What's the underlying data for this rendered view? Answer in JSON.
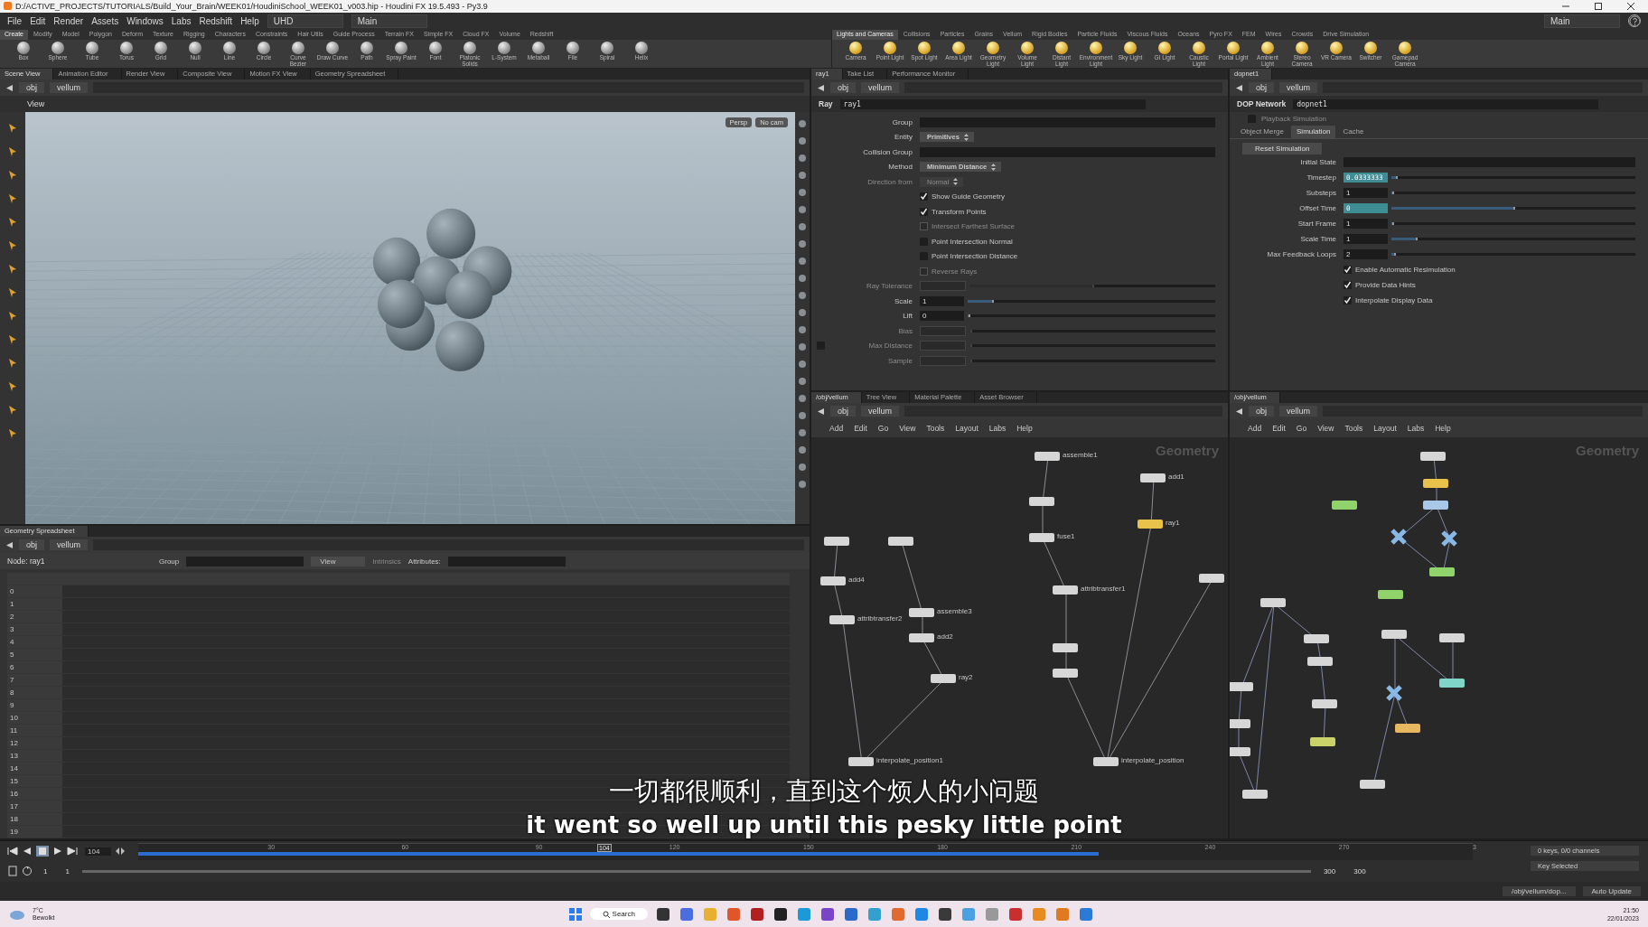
{
  "window": {
    "title": "D:/ACTIVE_PROJECTS/TUTORIALS/Build_Your_Brain/WEEK01/HoudiniSchool_WEEK01_v003.hip - Houdini FX 19.5.493 - Py3.9"
  },
  "menu": [
    "File",
    "Edit",
    "Render",
    "Assets",
    "Windows",
    "Labs",
    "Redshift",
    "Help"
  ],
  "desktop": "UHD",
  "layout_left": "Main",
  "layout_right": "Main",
  "shelf_left": {
    "tabs": [
      {
        "label": "Create",
        "selected": true
      },
      {
        "label": "Modify",
        "selected": false
      },
      {
        "label": "Model",
        "selected": false
      },
      {
        "label": "Polygon",
        "selected": false
      },
      {
        "label": "Deform",
        "selected": false
      },
      {
        "label": "Texture",
        "selected": false
      },
      {
        "label": "Rigging",
        "selected": false
      },
      {
        "label": "Characters",
        "selected": false
      },
      {
        "label": "Constraints",
        "selected": false
      },
      {
        "label": "Hair Utils",
        "selected": false
      },
      {
        "label": "Guide Process",
        "selected": false
      },
      {
        "label": "Terrain FX",
        "selected": false
      },
      {
        "label": "Simple FX",
        "selected": false
      },
      {
        "label": "Cloud FX",
        "selected": false
      },
      {
        "label": "Volume",
        "selected": false
      },
      {
        "label": "Redshift",
        "selected": false
      }
    ],
    "tools": [
      "Box",
      "Sphere",
      "Tube",
      "Torus",
      "Grid",
      "Null",
      "Line",
      "Circle",
      "Curve Bezier",
      "Draw Curve",
      "Path",
      "Spray Paint",
      "Font",
      "Platonic Solids",
      "L-System",
      "Metaball",
      "File",
      "Spiral",
      "Helix"
    ]
  },
  "shelf_right": {
    "tabs": [
      {
        "label": "Lights and Cameras",
        "selected": true
      },
      {
        "label": "Collisions",
        "selected": false
      },
      {
        "label": "Particles",
        "selected": false
      },
      {
        "label": "Grains",
        "selected": false
      },
      {
        "label": "Vellum",
        "selected": false
      },
      {
        "label": "Rigid Bodies",
        "selected": false
      },
      {
        "label": "Particle Fluids",
        "selected": false
      },
      {
        "label": "Viscous Fluids",
        "selected": false
      },
      {
        "label": "Oceans",
        "selected": false
      },
      {
        "label": "Pyro FX",
        "selected": false
      },
      {
        "label": "FEM",
        "selected": false
      },
      {
        "label": "Wires",
        "selected": false
      },
      {
        "label": "Crowds",
        "selected": false
      },
      {
        "label": "Drive Simulation",
        "selected": false
      }
    ],
    "tools": [
      "Camera",
      "Point Light",
      "Spot Light",
      "Area Light",
      "Geometry Light",
      "Volume Light",
      "Distant Light",
      "Environment Light",
      "Sky Light",
      "GI Light",
      "Caustic Light",
      "Portal Light",
      "Ambient Light",
      "Stereo Camera",
      "VR Camera",
      "Switcher",
      "Gamepad Camera"
    ]
  },
  "scene_pane": {
    "tabs": [
      {
        "label": "Scene View",
        "selected": true
      },
      {
        "label": "Animation Editor",
        "selected": false
      },
      {
        "label": "Render View",
        "selected": false
      },
      {
        "label": "Composite View",
        "selected": false
      },
      {
        "label": "Motion FX View",
        "selected": false
      },
      {
        "label": "Geometry Spreadsheet",
        "selected": false
      }
    ],
    "path": [
      "obj",
      "vellum"
    ],
    "view_label": "View",
    "camera_menus": [
      "Persp",
      "No cam"
    ]
  },
  "param_pane": {
    "tabs": [
      {
        "label": "ray1",
        "selected": true
      },
      {
        "label": "Take List",
        "selected": false
      },
      {
        "label": "Performance Monitor",
        "selected": false
      }
    ],
    "path": [
      "obj",
      "vellum"
    ],
    "node_type": "Ray",
    "node_name": "ray1",
    "params": [
      {
        "kind": "field",
        "label": "Group",
        "disabled": false
      },
      {
        "kind": "menu",
        "label": "Entity",
        "value": "Primitives",
        "disabled": false
      },
      {
        "kind": "field",
        "label": "Collision Group",
        "disabled": false
      },
      {
        "kind": "menu",
        "label": "Method",
        "value": "Minimum Distance",
        "disabled": false
      },
      {
        "kind": "menu",
        "label": "Direction from",
        "value": "Normal",
        "disabled": true
      },
      {
        "kind": "toggle",
        "label": "Show Guide Geometry",
        "checked": true,
        "disabled": false
      },
      {
        "kind": "toggle",
        "label": "Transform Points",
        "checked": true,
        "disabled": false
      },
      {
        "kind": "toggle",
        "label": "Intersect Farthest Surface",
        "checked": false,
        "disabled": true
      },
      {
        "kind": "toggle",
        "label": "Point Intersection Normal",
        "checked": false,
        "disabled": false
      },
      {
        "kind": "toggle",
        "label": "Point Intersection Distance",
        "checked": false,
        "disabled": false
      },
      {
        "kind": "toggle",
        "label": "Reverse Rays",
        "checked": false,
        "disabled": true
      },
      {
        "kind": "slider",
        "label": "Ray Tolerance",
        "level": 0.5,
        "disabled": true
      },
      {
        "kind": "slider",
        "label": "Scale",
        "value": "1",
        "level": 0.1,
        "disabled": false
      },
      {
        "kind": "slider",
        "label": "Lift",
        "value": "0",
        "level": 0,
        "disabled": false
      },
      {
        "kind": "slider",
        "label": "Bias",
        "level": 0,
        "disabled": true
      },
      {
        "kind": "slider",
        "label": "Max Distance",
        "level": 0,
        "disabled": true,
        "enable_checked": false
      },
      {
        "kind": "slider",
        "label": "Sample",
        "level": 0,
        "disabled": true
      }
    ]
  },
  "dop_pane": {
    "tabs": [
      {
        "label": "dopnet1",
        "selected": true
      }
    ],
    "path": [
      "obj",
      "vellum"
    ],
    "node_type": "DOP Network",
    "node_name": "dopnet1",
    "playback": {
      "label": "Playback Simulation",
      "checked": false,
      "disabled": true
    },
    "sub_tabs": [
      {
        "label": "Object Merge",
        "selected": false
      },
      {
        "label": "Simulation",
        "selected": true
      },
      {
        "label": "Cache",
        "selected": false
      }
    ],
    "reset_button": "Reset Simulation",
    "params": [
      {
        "kind": "field",
        "label": "Initial State"
      },
      {
        "kind": "slider",
        "label": "Timestep",
        "value": "0.0333333",
        "level": 0.02,
        "highlighted": true
      },
      {
        "kind": "slider",
        "label": "Substeps",
        "value": "1",
        "level": 0,
        "highlighted": false
      },
      {
        "kind": "slider",
        "label": "Offset Time",
        "value": "0",
        "level": 0.5,
        "highlighted": true
      },
      {
        "kind": "slider",
        "label": "Start Frame",
        "value": "1",
        "level": 0,
        "highlighted": false
      },
      {
        "kind": "slider",
        "label": "Scale Time",
        "value": "1",
        "level": 0.1,
        "highlighted": false
      },
      {
        "kind": "slider",
        "label": "Max Feedback Loops",
        "value": "2",
        "level": 0.01,
        "highlighted": false
      },
      {
        "kind": "toggle",
        "label": "Enable Automatic Resimulation",
        "checked": true
      },
      {
        "kind": "toggle",
        "label": "Provide Data Hints",
        "checked": true
      },
      {
        "kind": "toggle",
        "label": "Interpolate Display Data",
        "checked": true
      }
    ]
  },
  "spreadsheet": {
    "tabs": [
      {
        "label": "Geometry Spreadsheet",
        "selected": true
      }
    ],
    "path": [
      "obj",
      "vellum"
    ],
    "node": "Node: ray1",
    "group_label": "Group",
    "view_menu": "View",
    "intrinsics": "Intrinsics",
    "attributes_label": "Attributes:",
    "row_numbers": [
      "0",
      "1",
      "2",
      "3",
      "4",
      "5",
      "6",
      "7",
      "8",
      "9",
      "10",
      "11",
      "12",
      "13",
      "14",
      "15",
      "16",
      "17",
      "18",
      "19"
    ]
  },
  "network_mid": {
    "tabs": [
      {
        "label": "/obj/vellum",
        "selected": true
      },
      {
        "label": "Tree View",
        "selected": false
      },
      {
        "label": "Material Palette",
        "selected": false
      },
      {
        "label": "Asset Browser",
        "selected": false
      }
    ],
    "path": [
      "obj",
      "vellum"
    ],
    "menu": [
      "Add",
      "Edit",
      "Go",
      "View",
      "Tools",
      "Layout",
      "Labs",
      "Help"
    ],
    "context": "Geometry",
    "nodes": [
      {
        "label": "assemble1",
        "color": "#d6d6d6"
      },
      {
        "label": "add1",
        "color": "#d6d6d6"
      },
      {
        "color": "#d6d6d6"
      },
      {
        "label": "fuse1",
        "color": "#d6d6d6"
      },
      {
        "label": "ray1",
        "color": "#e8c24a"
      },
      {
        "color": "#d6d6d6"
      },
      {
        "color": "#d6d6d6"
      },
      {
        "label": "add4",
        "color": "#d6d6d6"
      },
      {
        "label": "attribtransfer2",
        "color": "#d6d6d6"
      },
      {
        "label": "assemble3",
        "color": "#d6d6d6"
      },
      {
        "label": "add2",
        "color": "#d6d6d6"
      },
      {
        "label": "ray2",
        "color": "#d6d6d6"
      },
      {
        "label": "attribtransfer1",
        "color": "#d6d6d6"
      },
      {
        "color": "#d6d6d6"
      },
      {
        "color": "#d6d6d6"
      },
      {
        "label": "interpolate_position1",
        "color": "#d6d6d6"
      },
      {
        "label": "interpolate_position",
        "color": "#d6d6d6"
      },
      {
        "color": "#d6d6d6"
      }
    ]
  },
  "network_right": {
    "tabs": [
      {
        "label": "/obj/vellum",
        "selected": true
      }
    ],
    "path": [
      "obj",
      "vellum"
    ],
    "menu": [
      "Add",
      "Edit",
      "Go",
      "View",
      "Tools",
      "Layout",
      "Labs",
      "Help"
    ],
    "context": "Geometry",
    "nodes": [
      {
        "kind": "box",
        "color": "#d6d6d6"
      },
      {
        "kind": "box",
        "color": "#e8c24a"
      },
      {
        "kind": "box",
        "color": "#a9c8e8"
      },
      {
        "kind": "box",
        "color": "#8fd36a"
      },
      {
        "kind": "cross",
        "color": "#8ab8e6"
      },
      {
        "kind": "cross",
        "color": "#8ab8e6"
      },
      {
        "kind": "box",
        "color": "#8fd36a"
      },
      {
        "kind": "box",
        "color": "#8fd36a"
      },
      {
        "kind": "box",
        "color": "#d6d6d6"
      },
      {
        "kind": "box",
        "color": "#d6d6d6"
      },
      {
        "kind": "box",
        "color": "#d6d6d6"
      },
      {
        "kind": "box",
        "color": "#d6d6d6"
      },
      {
        "kind": "box",
        "color": "#d6d6d6"
      },
      {
        "kind": "box",
        "color": "#7fd6c8"
      },
      {
        "kind": "cross",
        "color": "#8ab8e6"
      },
      {
        "kind": "box",
        "color": "#d6d6d6"
      },
      {
        "kind": "box",
        "color": "#d6d6d6"
      },
      {
        "kind": "box",
        "color": "#c9d36a"
      },
      {
        "kind": "box",
        "color": "#e8b860"
      },
      {
        "kind": "box",
        "color": "#d6d6d6"
      },
      {
        "kind": "box",
        "color": "#d6d6d6"
      },
      {
        "kind": "box",
        "color": "#d6d6d6"
      },
      {
        "kind": "box",
        "color": "#d6d6d6"
      }
    ]
  },
  "timeline": {
    "frame": "104",
    "ticks": [
      "30",
      "60",
      "90",
      "120",
      "150",
      "180",
      "210",
      "240",
      "270",
      "3"
    ],
    "playhead": {
      "label": "104",
      "level": 0.344
    },
    "cache": {
      "level": 0.72
    },
    "range_start": "1",
    "range_start2": "1",
    "range_end": "300",
    "range_end2": "300",
    "keys_info": "0 keys, 0/0 channels",
    "key_menu": "Key Selected"
  },
  "status": {
    "path": "/obj/vellum/dop...",
    "update_mode": "Auto Update"
  },
  "subtitles": {
    "chinese": "一切都很顺利，直到这个烦人的小问题",
    "english": "it went so well up until this pesky little point"
  },
  "taskbar": {
    "weather": "7°C",
    "weather_text": "Bewolkt",
    "search": "Search",
    "time": "21:50",
    "date": "22/01/2023"
  }
}
